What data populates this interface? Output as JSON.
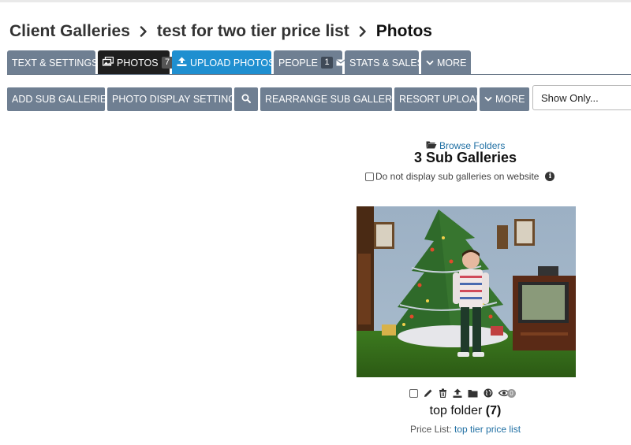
{
  "breadcrumb": {
    "items": [
      "Client Galleries",
      "test for two tier price list",
      "Photos"
    ]
  },
  "tabs": [
    {
      "label": "TEXT & SETTINGS"
    },
    {
      "label": "PHOTOS",
      "count": "7"
    },
    {
      "label": "UPLOAD PHOTOS"
    },
    {
      "label": "PEOPLE",
      "count": "1"
    },
    {
      "label": "STATS & SALES"
    },
    {
      "label": "MORE"
    }
  ],
  "toolbar": {
    "buttons": [
      "ADD SUB GALLERIES",
      "PHOTO DISPLAY SETTINGS",
      "REARRANGE SUB GALLERIES",
      "RESORT UPLOAD",
      "MORE"
    ],
    "filter_value": "Show Only..."
  },
  "galleries": {
    "browse_label": "Browse Folders",
    "title": "3 Sub Galleries",
    "no_display_label": "Do not display sub galleries on website",
    "folder": {
      "name": "top folder",
      "count": "(7)",
      "views": "0",
      "price_list_label": "Price List:",
      "price_list": "top tier price list"
    }
  },
  "colors": {
    "tab_bg": "#6f7f92",
    "tab_active": "#1f1f1f",
    "upload_bg": "#1f8fd0",
    "link": "#1f6fa3"
  },
  "icons": {
    "breadcrumb_separator": "chevron-right-icon",
    "photos_tab": "photos-icon",
    "upload_tab": "upload-icon",
    "people_tab": "envelope-icon",
    "more": "chevron-down-icon",
    "search": "search-icon",
    "browse": "folder-open-icon",
    "info": "info-icon",
    "folder_actions": [
      "edit-icon",
      "trash-icon",
      "upload-icon",
      "folder-icon",
      "globe-icon",
      "eye-icon"
    ]
  }
}
